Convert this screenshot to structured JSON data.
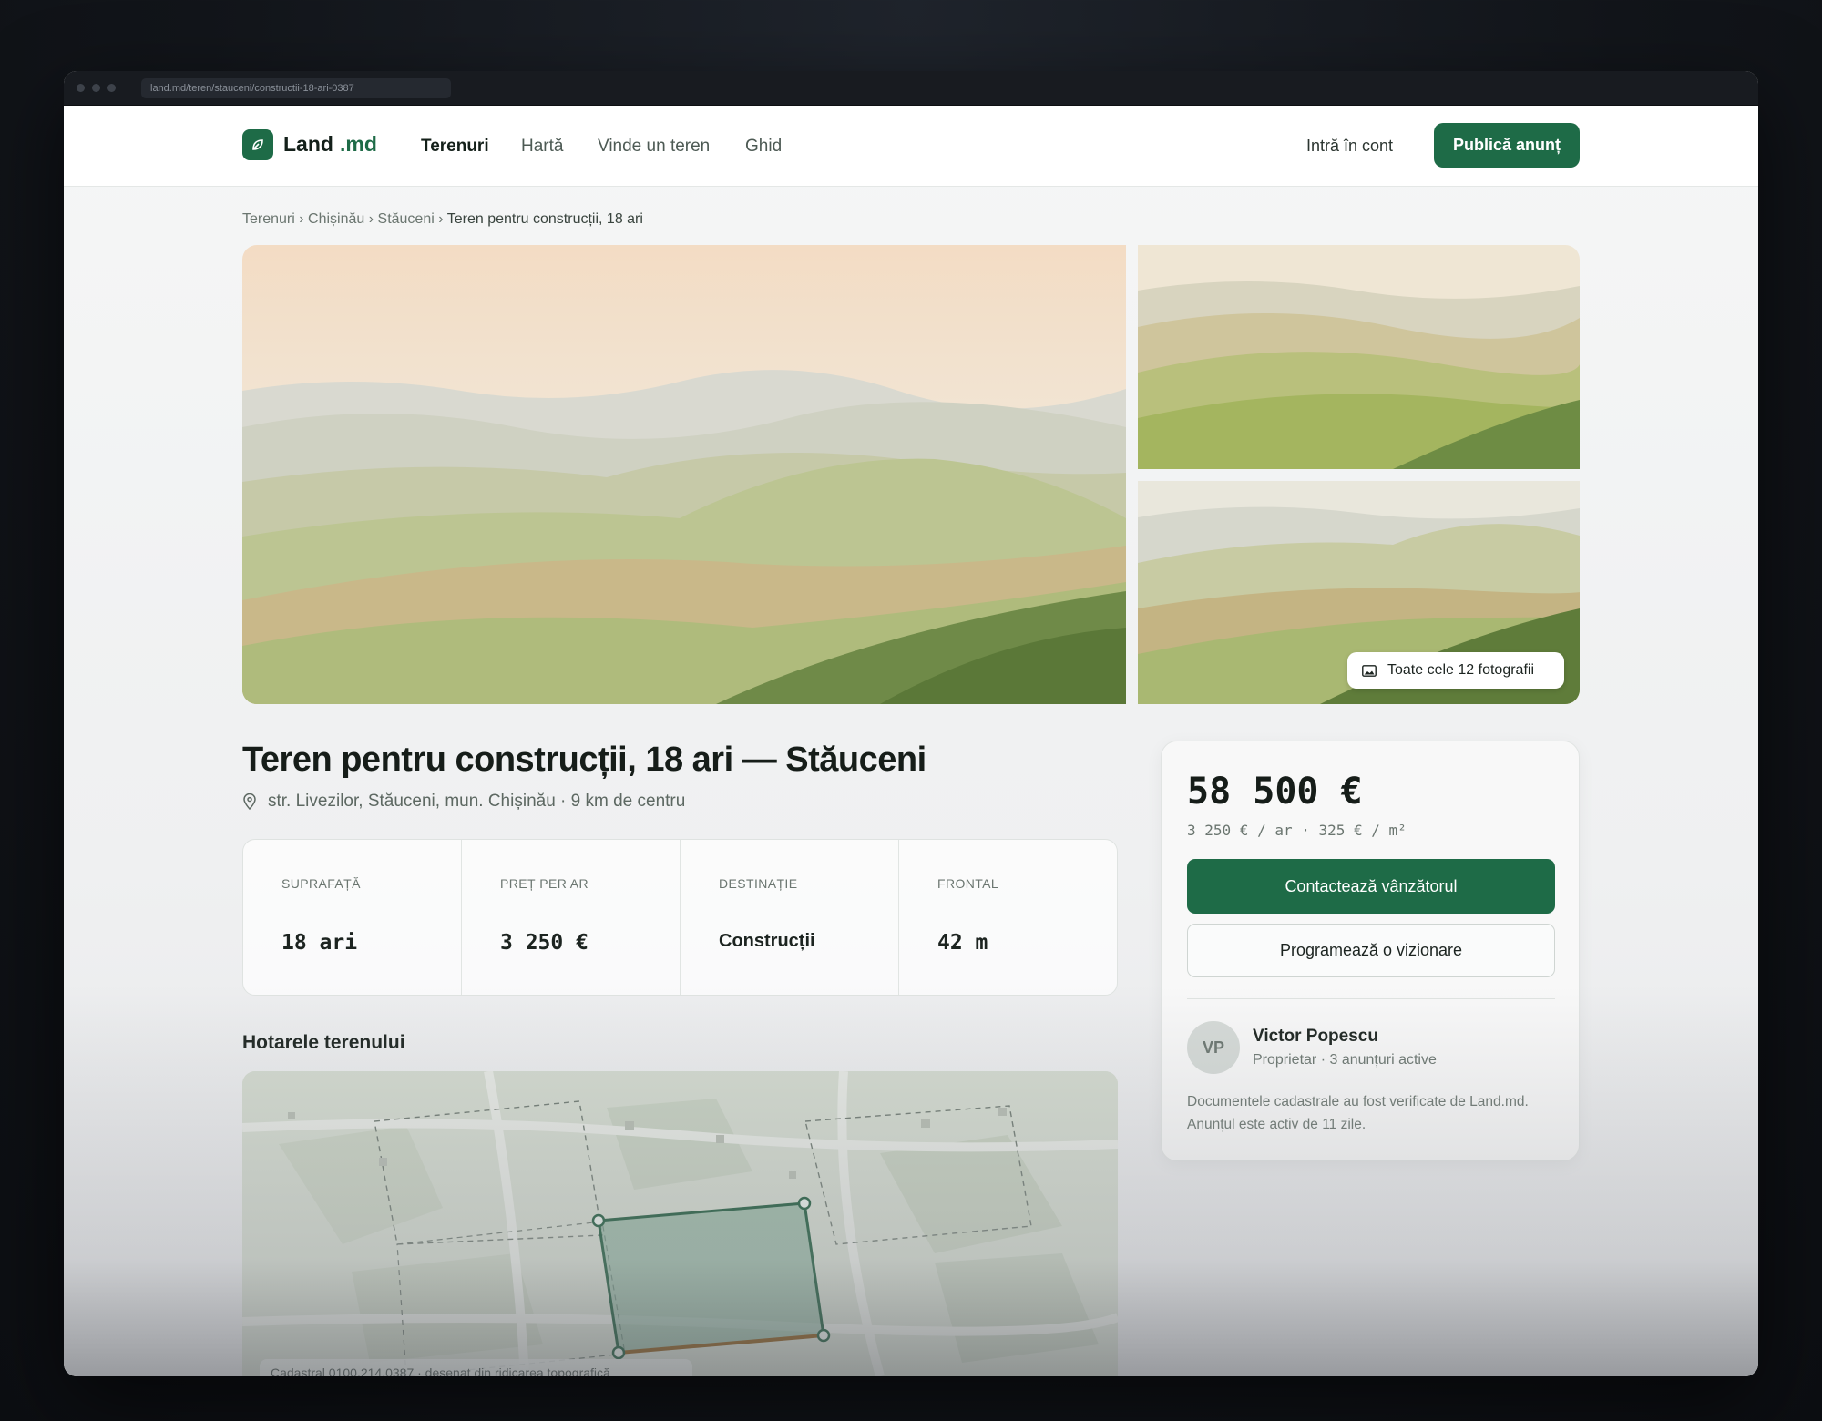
{
  "browser": {
    "url": "land.md/teren/stauceni/constructii-18-ari-0387"
  },
  "header": {
    "logo_name": "Land",
    "logo_tld": ".md",
    "nav": [
      "Terenuri",
      "Hartă",
      "Vinde un teren",
      "Ghid"
    ],
    "active_nav": "Terenuri",
    "login_label": "Intră în cont",
    "publish_label": "Publică anunț"
  },
  "breadcrumbs": [
    "Terenuri",
    "Chișinău",
    "Stăuceni",
    "Teren pentru construcții, 18 ari"
  ],
  "gallery": {
    "all_photos_label": "Toate cele 12 fotografii"
  },
  "listing": {
    "title": "Teren pentru construcții, 18 ari — Stăuceni",
    "address": "str. Livezilor, Stăuceni, mun. Chișinău · 9 km de centru",
    "stats": [
      {
        "label": "SUPRAFAȚĂ",
        "value": "18 ari"
      },
      {
        "label": "PREȚ PER AR",
        "value": "3 250 €"
      },
      {
        "label": "DESTINAȚIE",
        "value": "Construcții"
      },
      {
        "label": "FRONTAL",
        "value": "42 m"
      }
    ],
    "boundaries_title": "Hotarele terenului",
    "map_note": "Cadastral 0100.214.0387 · desenat din ridicarea topografică"
  },
  "price_card": {
    "price": "58 500 €",
    "price_detail": "3 250 € / ar · 325 € / m²",
    "contact_label": "Contactează vânzătorul",
    "schedule_label": "Programează o vizionare",
    "seller": {
      "initials": "VP",
      "name": "Victor Popescu",
      "meta": "Proprietar · 3 anunțuri active"
    },
    "note": "Documentele cadastrale au fost verificate de Land.md. Anunțul este activ de 11 zile."
  },
  "colors": {
    "brand": "#1e6b47",
    "parcel_fill": "#6e9f86",
    "frontage": "#8a5a1c"
  },
  "icons": [
    "leaf-icon",
    "image-icon",
    "location-pin-icon",
    "window-dot"
  ]
}
